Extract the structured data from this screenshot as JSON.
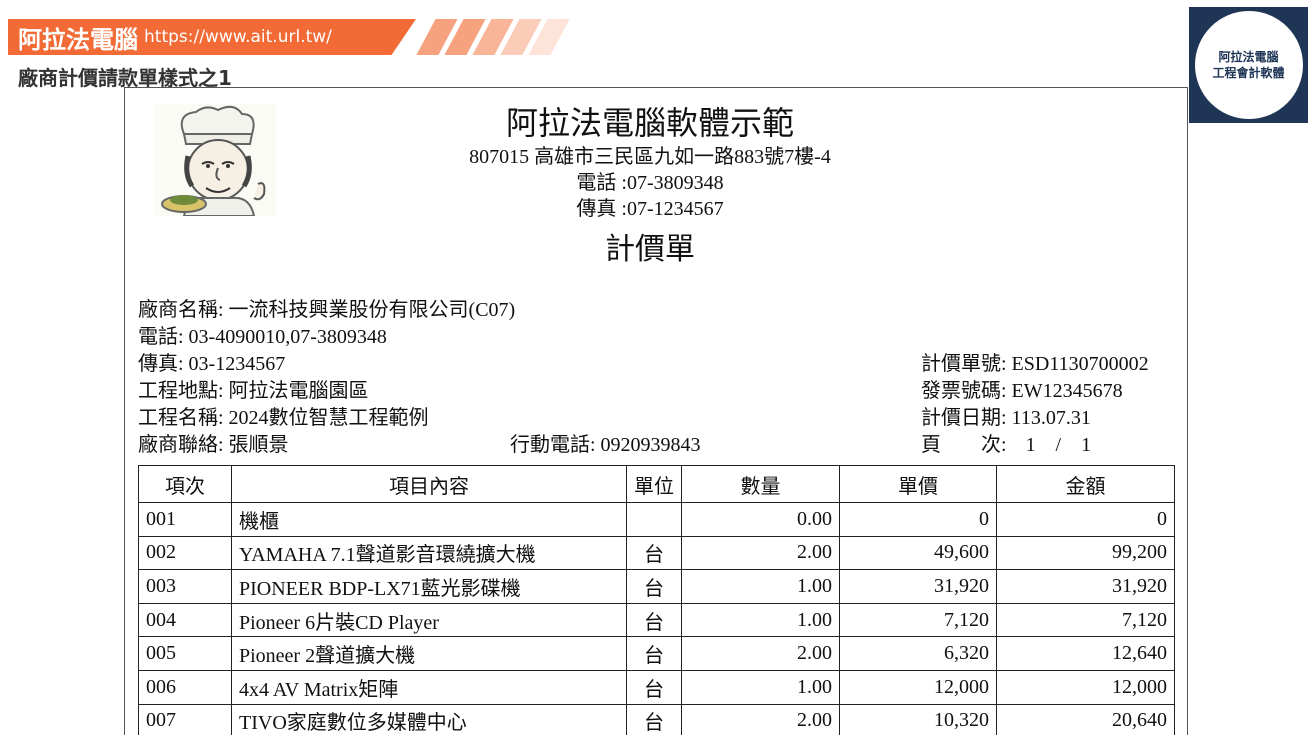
{
  "banner": {
    "title": "阿拉法電腦",
    "url": "https://www.ait.url.tw/",
    "subtitle": "廠商計價請款單樣式之1",
    "accent_color": "#f26a35"
  },
  "badge": {
    "line1": "阿拉法電腦",
    "line2": "工程會計軟體",
    "color": "#1f3556"
  },
  "document": {
    "company": "阿拉法電腦軟體示範",
    "address": "807015 高雄市三民區九如一路883號7樓-4",
    "phone": "電話 :07-3809348",
    "fax": "傳真 :07-1234567",
    "title": "計價單",
    "vendor_name": "廠商名稱: 一流科技興業股份有限公司(C07)",
    "vendor_phone": "電話: 03-4090010,07-3809348",
    "vendor_fax": "傳真: 03-1234567",
    "site": "工程地點: 阿拉法電腦園區",
    "project": "工程名稱: 2024數位智慧工程範例",
    "contact": "廠商聯絡: 張順景",
    "mobile": "行動電話: 0920939843",
    "bill_no": "計價單號: ESD1130700002",
    "invoice_no": "發票號碼: EW12345678",
    "bill_date": "計價日期: 113.07.31",
    "page_label": "頁　　次:",
    "page_value": "1　/　1"
  },
  "table": {
    "headers": [
      "項次",
      "項目內容",
      "單位",
      "數量",
      "單價",
      "金額"
    ],
    "rows": [
      {
        "seq": "001",
        "item": "機櫃",
        "unit": "",
        "qty": "0.00",
        "price": "0",
        "amount": "0"
      },
      {
        "seq": "002",
        "item": "YAMAHA 7.1聲道影音環繞擴大機",
        "unit": "台",
        "qty": "2.00",
        "price": "49,600",
        "amount": "99,200"
      },
      {
        "seq": "003",
        "item": "PIONEER BDP-LX71藍光影碟機",
        "unit": "台",
        "qty": "1.00",
        "price": "31,920",
        "amount": "31,920"
      },
      {
        "seq": "004",
        "item": "Pioneer 6片裝CD Player",
        "unit": "台",
        "qty": "1.00",
        "price": "7,120",
        "amount": "7,120"
      },
      {
        "seq": "005",
        "item": "Pioneer 2聲道擴大機",
        "unit": "台",
        "qty": "2.00",
        "price": "6,320",
        "amount": "12,640"
      },
      {
        "seq": "006",
        "item": "4x4 AV Matrix矩陣",
        "unit": "台",
        "qty": "1.00",
        "price": "12,000",
        "amount": "12,000"
      },
      {
        "seq": "007",
        "item": "TIVO家庭數位多媒體中心",
        "unit": "台",
        "qty": "2.00",
        "price": "10,320",
        "amount": "20,640"
      }
    ]
  }
}
